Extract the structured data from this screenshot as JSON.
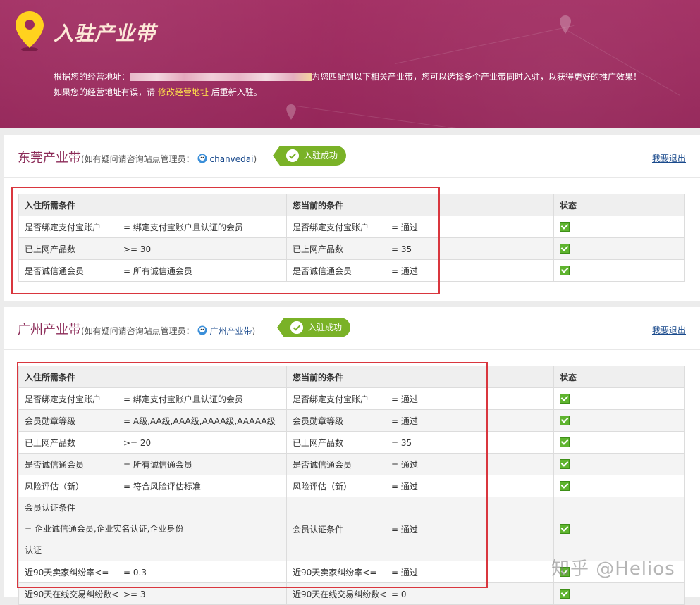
{
  "banner": {
    "title": "入驻产业带",
    "line1_prefix": "根据您的经营地址：",
    "line1_suffix": "为您匹配到以下相关产业带，您可以选择多个产业带同时入驻，以获得更好的推广效果！",
    "line2_prefix": "如果您的经营地址有误，请",
    "line2_link": "修改经营地址",
    "line2_suffix": "后重新入驻。"
  },
  "colors": {
    "banner": "#9c2a5f",
    "title": "#8b2a57",
    "badge": "#7ab227",
    "link": "#1a4a8c",
    "redbox": "#d9363e"
  },
  "headers": {
    "required": "入住所需条件",
    "current": "您当前的条件",
    "status": "状态"
  },
  "belts": [
    {
      "name": "东莞产业带",
      "note_prefix": "(如有疑问请咨询站点管理员：",
      "admin": "chanvedai",
      "note_suffix": ")",
      "badge": "入驻成功",
      "quit": "我要退出",
      "rows": [
        {
          "req_k": "是否绑定支付宝账户",
          "req_v": "= 绑定支付宝账户且认证的会员",
          "cur_k": "是否绑定支付宝账户",
          "cur_v": "= 通过"
        },
        {
          "req_k": "已上网产品数",
          "req_v": ">= 30",
          "cur_k": "已上网产品数",
          "cur_v": "= 35"
        },
        {
          "req_k": "是否诚信通会员",
          "req_v": "= 所有诚信通会员",
          "cur_k": "是否诚信通会员",
          "cur_v": "= 通过"
        }
      ]
    },
    {
      "name": "广州产业带",
      "note_prefix": "(如有疑问请咨询站点管理员：",
      "admin": "广州产业带",
      "note_suffix": ")",
      "badge": "入驻成功",
      "quit": "我要退出",
      "rows": [
        {
          "req_k": "是否绑定支付宝账户",
          "req_v": "= 绑定支付宝账户且认证的会员",
          "cur_k": "是否绑定支付宝账户",
          "cur_v": "= 通过"
        },
        {
          "req_k": "会员勋章等级",
          "req_v": "= A级,AA级,AAA级,AAAA级,AAAAA级",
          "cur_k": "会员勋章等级",
          "cur_v": "= 通过"
        },
        {
          "req_k": "已上网产品数",
          "req_v": ">= 20",
          "cur_k": "已上网产品数",
          "cur_v": "= 35"
        },
        {
          "req_k": "是否诚信通会员",
          "req_v": "= 所有诚信通会员",
          "cur_k": "是否诚信通会员",
          "cur_v": "= 通过"
        },
        {
          "req_k": "风险评估（新）",
          "req_v": "= 符合风险评估标准",
          "cur_k": "风险评估（新）",
          "cur_v": "= 通过"
        },
        {
          "req_k": "会员认证条件",
          "req_v": "= 企业诚信通会员,企业实名认证,企业身份",
          "req_k2": "认证",
          "cur_k": "会员认证条件",
          "cur_v": "= 通过"
        },
        {
          "req_k": "近90天卖家纠纷率<=",
          "req_v": "= 0.3",
          "cur_k": "近90天卖家纠纷率<=",
          "cur_v": "= 通过"
        },
        {
          "req_k": "近90天在线交易纠纷数<",
          "req_v": ">= 3",
          "cur_k": "近90天在线交易纠纷数<",
          "cur_v": "= 0"
        }
      ]
    }
  ],
  "watermark": "知乎 @Helios"
}
